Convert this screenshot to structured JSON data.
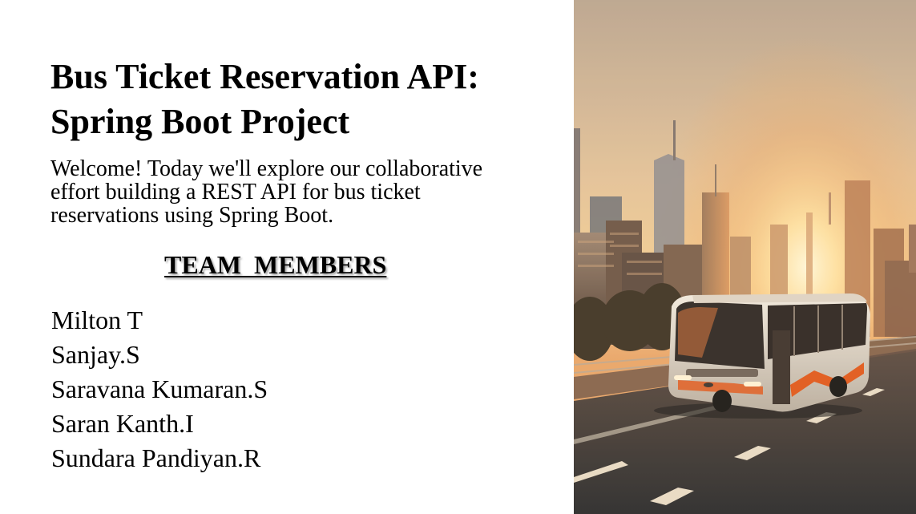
{
  "slide": {
    "title": "Bus Ticket Reservation API: Spring Boot Project",
    "subtitle": "Welcome! Today we'll explore our collaborative effort building a REST API for bus ticket reservations using Spring Boot.",
    "team_heading": "TEAM  MEMBERS",
    "members": [
      "Milton T",
      "Sanjay.S",
      "Saravana Kumaran.S",
      "Saran Kanth.I",
      "Sundara Pandiyan.R"
    ]
  },
  "colors": {
    "text": "#000000",
    "background": "#ffffff",
    "sky_top": "#c9a98c",
    "sun": "#fff2c8",
    "road": "#3a3d42",
    "bus_body": "#e9e2d8",
    "bus_accent": "#e0571c"
  },
  "image": {
    "subject": "city-skyline-sunset-bus"
  }
}
